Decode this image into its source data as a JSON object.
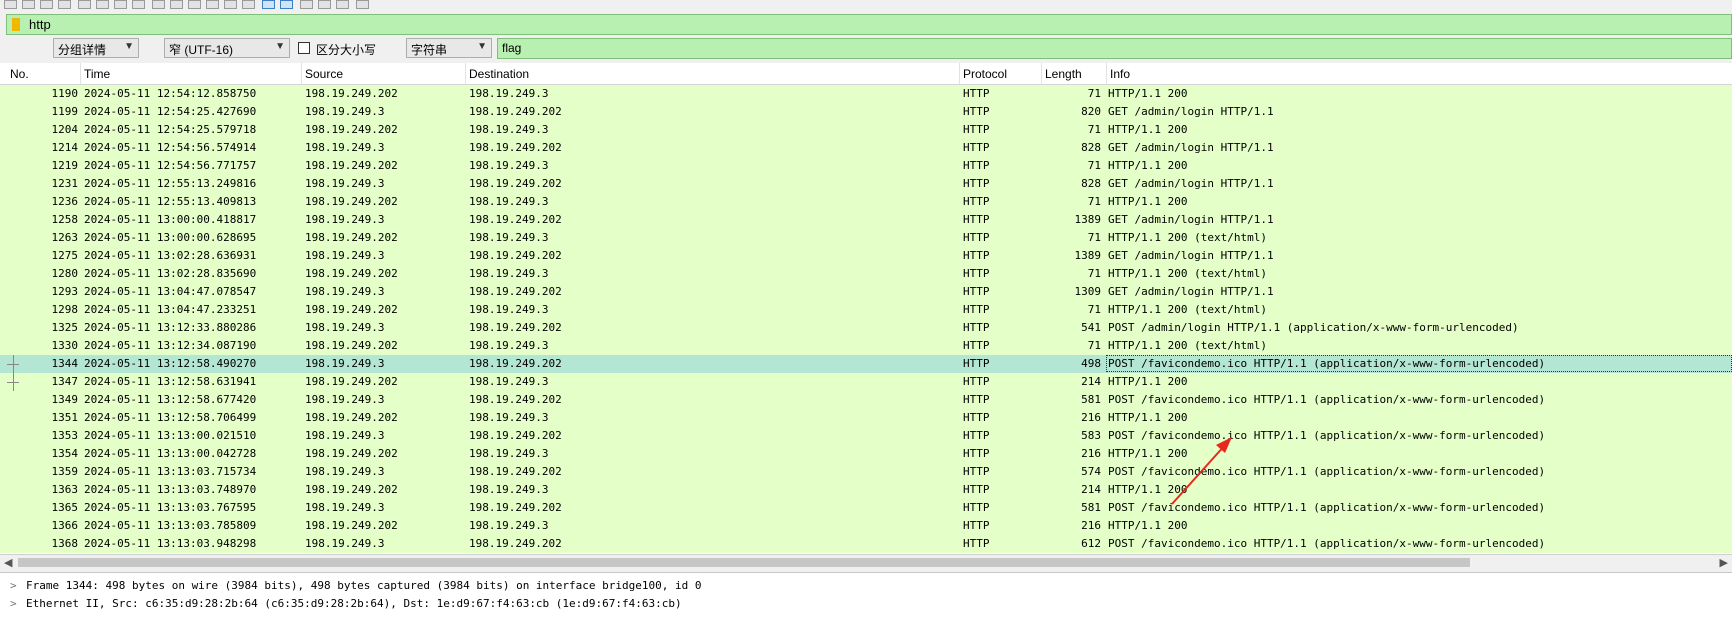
{
  "display_filter": {
    "value": "http"
  },
  "find_bar": {
    "search_in": "分组详情",
    "char_width": "窄 (UTF-16)",
    "case_label": "区分大小写",
    "search_type": "字符串",
    "search_value": "flag"
  },
  "columns": {
    "no": "No.",
    "time": "Time",
    "source": "Source",
    "destination": "Destination",
    "protocol": "Protocol",
    "length": "Length",
    "info": "Info"
  },
  "packets": [
    {
      "no": "1190",
      "time": "2024-05-11 12:54:12.858750",
      "src": "198.19.249.202",
      "dst": "198.19.249.3",
      "proto": "HTTP",
      "len": "71",
      "info": "HTTP/1.1 200"
    },
    {
      "no": "1199",
      "time": "2024-05-11 12:54:25.427690",
      "src": "198.19.249.3",
      "dst": "198.19.249.202",
      "proto": "HTTP",
      "len": "820",
      "info": "GET /admin/login HTTP/1.1"
    },
    {
      "no": "1204",
      "time": "2024-05-11 12:54:25.579718",
      "src": "198.19.249.202",
      "dst": "198.19.249.3",
      "proto": "HTTP",
      "len": "71",
      "info": "HTTP/1.1 200"
    },
    {
      "no": "1214",
      "time": "2024-05-11 12:54:56.574914",
      "src": "198.19.249.3",
      "dst": "198.19.249.202",
      "proto": "HTTP",
      "len": "828",
      "info": "GET /admin/login HTTP/1.1"
    },
    {
      "no": "1219",
      "time": "2024-05-11 12:54:56.771757",
      "src": "198.19.249.202",
      "dst": "198.19.249.3",
      "proto": "HTTP",
      "len": "71",
      "info": "HTTP/1.1 200"
    },
    {
      "no": "1231",
      "time": "2024-05-11 12:55:13.249816",
      "src": "198.19.249.3",
      "dst": "198.19.249.202",
      "proto": "HTTP",
      "len": "828",
      "info": "GET /admin/login HTTP/1.1"
    },
    {
      "no": "1236",
      "time": "2024-05-11 12:55:13.409813",
      "src": "198.19.249.202",
      "dst": "198.19.249.3",
      "proto": "HTTP",
      "len": "71",
      "info": "HTTP/1.1 200"
    },
    {
      "no": "1258",
      "time": "2024-05-11 13:00:00.418817",
      "src": "198.19.249.3",
      "dst": "198.19.249.202",
      "proto": "HTTP",
      "len": "1389",
      "info": "GET /admin/login HTTP/1.1"
    },
    {
      "no": "1263",
      "time": "2024-05-11 13:00:00.628695",
      "src": "198.19.249.202",
      "dst": "198.19.249.3",
      "proto": "HTTP",
      "len": "71",
      "info": "HTTP/1.1 200   (text/html)"
    },
    {
      "no": "1275",
      "time": "2024-05-11 13:02:28.636931",
      "src": "198.19.249.3",
      "dst": "198.19.249.202",
      "proto": "HTTP",
      "len": "1389",
      "info": "GET /admin/login HTTP/1.1"
    },
    {
      "no": "1280",
      "time": "2024-05-11 13:02:28.835690",
      "src": "198.19.249.202",
      "dst": "198.19.249.3",
      "proto": "HTTP",
      "len": "71",
      "info": "HTTP/1.1 200   (text/html)"
    },
    {
      "no": "1293",
      "time": "2024-05-11 13:04:47.078547",
      "src": "198.19.249.3",
      "dst": "198.19.249.202",
      "proto": "HTTP",
      "len": "1309",
      "info": "GET /admin/login HTTP/1.1"
    },
    {
      "no": "1298",
      "time": "2024-05-11 13:04:47.233251",
      "src": "198.19.249.202",
      "dst": "198.19.249.3",
      "proto": "HTTP",
      "len": "71",
      "info": "HTTP/1.1 200   (text/html)"
    },
    {
      "no": "1325",
      "time": "2024-05-11 13:12:33.880286",
      "src": "198.19.249.3",
      "dst": "198.19.249.202",
      "proto": "HTTP",
      "len": "541",
      "info": "POST /admin/login HTTP/1.1  (application/x-www-form-urlencoded)"
    },
    {
      "no": "1330",
      "time": "2024-05-11 13:12:34.087190",
      "src": "198.19.249.202",
      "dst": "198.19.249.3",
      "proto": "HTTP",
      "len": "71",
      "info": "HTTP/1.1 200   (text/html)"
    },
    {
      "no": "1344",
      "time": "2024-05-11 13:12:58.490270",
      "src": "198.19.249.3",
      "dst": "198.19.249.202",
      "proto": "HTTP",
      "len": "498",
      "info": "POST /favicondemo.ico HTTP/1.1  (application/x-www-form-urlencoded)",
      "selected": true
    },
    {
      "no": "1347",
      "time": "2024-05-11 13:12:58.631941",
      "src": "198.19.249.202",
      "dst": "198.19.249.3",
      "proto": "HTTP",
      "len": "214",
      "info": "HTTP/1.1 200"
    },
    {
      "no": "1349",
      "time": "2024-05-11 13:12:58.677420",
      "src": "198.19.249.3",
      "dst": "198.19.249.202",
      "proto": "HTTP",
      "len": "581",
      "info": "POST /favicondemo.ico HTTP/1.1  (application/x-www-form-urlencoded)"
    },
    {
      "no": "1351",
      "time": "2024-05-11 13:12:58.706499",
      "src": "198.19.249.202",
      "dst": "198.19.249.3",
      "proto": "HTTP",
      "len": "216",
      "info": "HTTP/1.1 200"
    },
    {
      "no": "1353",
      "time": "2024-05-11 13:13:00.021510",
      "src": "198.19.249.3",
      "dst": "198.19.249.202",
      "proto": "HTTP",
      "len": "583",
      "info": "POST /favicondemo.ico HTTP/1.1  (application/x-www-form-urlencoded)"
    },
    {
      "no": "1354",
      "time": "2024-05-11 13:13:00.042728",
      "src": "198.19.249.202",
      "dst": "198.19.249.3",
      "proto": "HTTP",
      "len": "216",
      "info": "HTTP/1.1 200"
    },
    {
      "no": "1359",
      "time": "2024-05-11 13:13:03.715734",
      "src": "198.19.249.3",
      "dst": "198.19.249.202",
      "proto": "HTTP",
      "len": "574",
      "info": "POST /favicondemo.ico HTTP/1.1  (application/x-www-form-urlencoded)"
    },
    {
      "no": "1363",
      "time": "2024-05-11 13:13:03.748970",
      "src": "198.19.249.202",
      "dst": "198.19.249.3",
      "proto": "HTTP",
      "len": "214",
      "info": "HTTP/1.1 200"
    },
    {
      "no": "1365",
      "time": "2024-05-11 13:13:03.767595",
      "src": "198.19.249.3",
      "dst": "198.19.249.202",
      "proto": "HTTP",
      "len": "581",
      "info": "POST /favicondemo.ico HTTP/1.1  (application/x-www-form-urlencoded)"
    },
    {
      "no": "1366",
      "time": "2024-05-11 13:13:03.785809",
      "src": "198.19.249.202",
      "dst": "198.19.249.3",
      "proto": "HTTP",
      "len": "216",
      "info": "HTTP/1.1 200"
    },
    {
      "no": "1368",
      "time": "2024-05-11 13:13:03.948298",
      "src": "198.19.249.3",
      "dst": "198.19.249.202",
      "proto": "HTTP",
      "len": "612",
      "info": "POST /favicondemo.ico HTTP/1.1  (application/x-www-form-urlencoded)"
    }
  ],
  "details": [
    "Frame 1344: 498 bytes on wire (3984 bits), 498 bytes captured (3984 bits) on interface bridge100, id 0",
    "Ethernet II, Src: c6:35:d9:28:2b:64 (c6:35:d9:28:2b:64), Dst: 1e:d9:67:f4:63:cb (1e:d9:67:f4:63:cb)"
  ],
  "colors": {
    "row_bg": "#e4ffc7",
    "selected_row_bg": "#b3e6d3",
    "filter_bg": "#b7f0b0",
    "annotation_arrow": "#e8281e"
  },
  "icons": [
    "bookmark-icon",
    "chevron-right-icon",
    "annotation-arrow-icon",
    "scroll-left-icon",
    "scroll-right-icon"
  ]
}
